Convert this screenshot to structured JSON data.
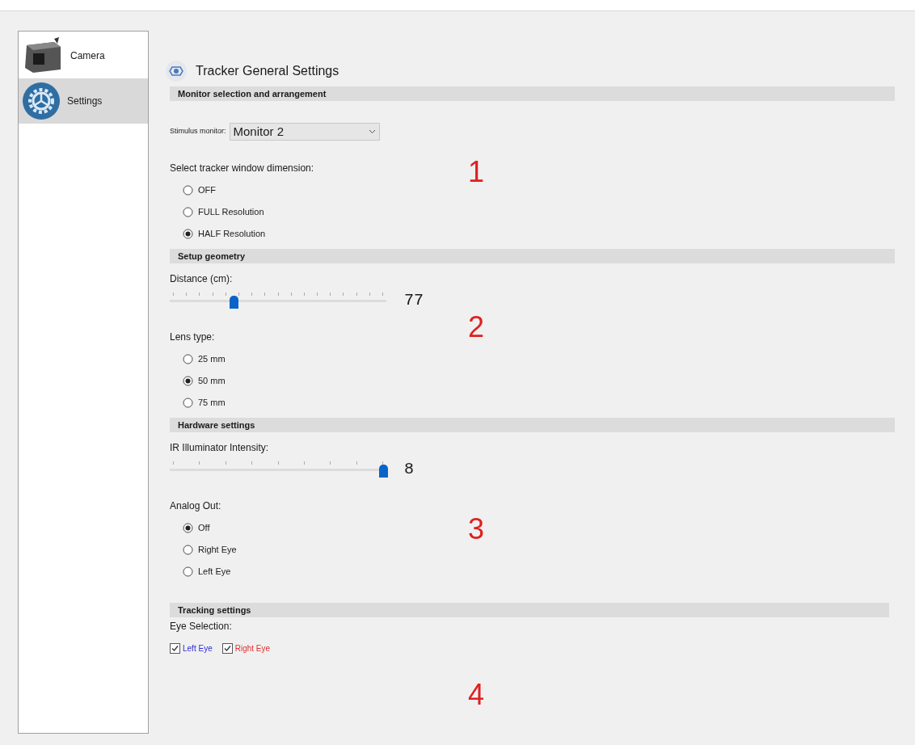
{
  "sidebar": {
    "items": [
      {
        "label": "Camera",
        "selected": false
      },
      {
        "label": "Settings",
        "selected": true
      }
    ]
  },
  "title": "Tracker General Settings",
  "sections": [
    {
      "header": "Monitor selection and arrangement",
      "annotation": "1",
      "controls": [
        {
          "kind": "dropdown",
          "label": "Stimulus monitor:",
          "value": "Monitor 2"
        },
        {
          "kind": "radio_group",
          "label": "Select tracker window dimension:",
          "options": [
            {
              "label": "OFF",
              "selected": false
            },
            {
              "label": "FULL Resolution",
              "selected": false
            },
            {
              "label": "HALF Resolution",
              "selected": true
            }
          ]
        }
      ]
    },
    {
      "header": "Setup geometry",
      "annotation": "2",
      "controls": [
        {
          "kind": "slider",
          "label": "Distance (cm):",
          "level": 0.29,
          "reading": "77"
        },
        {
          "kind": "radio_group",
          "label": "Lens type:",
          "options": [
            {
              "label": "25 mm",
              "selected": false
            },
            {
              "label": "50 mm",
              "selected": true
            },
            {
              "label": "75 mm",
              "selected": false
            }
          ]
        }
      ]
    },
    {
      "header": "Hardware settings",
      "annotation": "3",
      "controls": [
        {
          "kind": "slider",
          "label": "IR Illuminator Intensity:",
          "level": 1,
          "reading": "8"
        },
        {
          "kind": "radio_group",
          "label": "Analog Out:",
          "options": [
            {
              "label": "Off",
              "selected": true
            },
            {
              "label": "Right Eye",
              "selected": false
            },
            {
              "label": "Left Eye",
              "selected": false
            }
          ]
        }
      ]
    },
    {
      "header": "Tracking settings",
      "annotation": "4",
      "controls": [
        {
          "kind": "checkbox_group",
          "label": "Eye Selection:",
          "options": [
            {
              "label": "Left Eye",
              "checked": true,
              "color": "#2b2bd6"
            },
            {
              "label": "Right Eye",
              "checked": true,
              "color": "#e03030"
            }
          ]
        }
      ]
    }
  ]
}
